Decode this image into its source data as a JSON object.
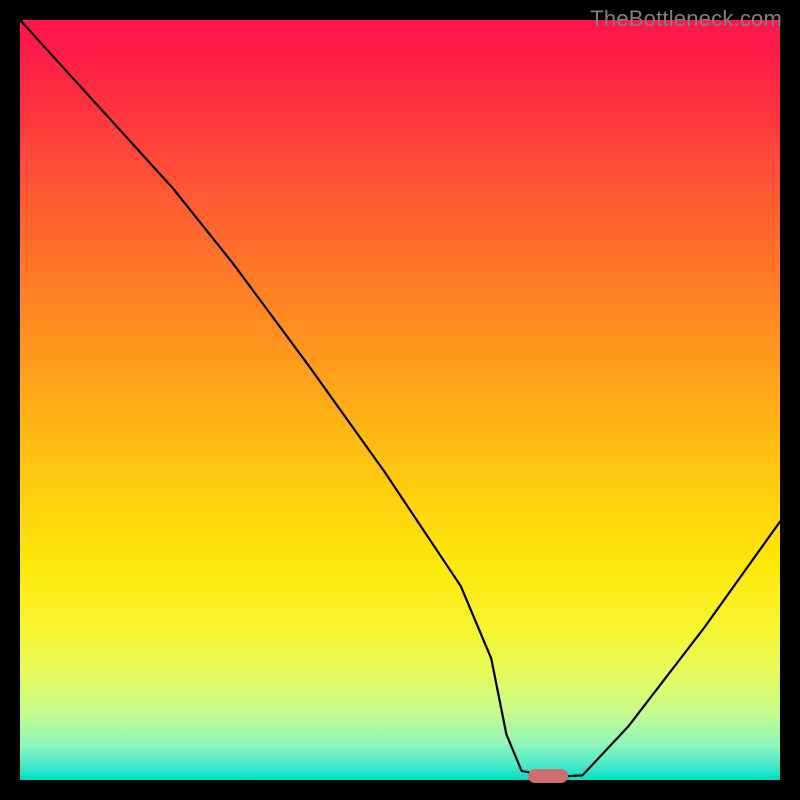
{
  "watermark": "TheBottleneck.com",
  "chart_data": {
    "type": "line",
    "title": "",
    "xlabel": "",
    "ylabel": "",
    "xlim": [
      0,
      100
    ],
    "ylim": [
      0,
      100
    ],
    "series": [
      {
        "name": "bottleneck-curve",
        "x": [
          0,
          10,
          20,
          28,
          38,
          48,
          58,
          62,
          64,
          66,
          70,
          74,
          80,
          90,
          100
        ],
        "values": [
          100,
          89,
          78,
          68,
          54.5,
          40.5,
          25.5,
          16,
          6,
          1.2,
          0.4,
          0.6,
          7,
          20,
          34
        ]
      }
    ],
    "marker": {
      "x": 69.5,
      "y": 0.5,
      "color": "#cc6b70"
    },
    "background_gradient": {
      "top": "#ff164c",
      "mid": "#ffe60d",
      "bottom": "#00dec1"
    }
  }
}
